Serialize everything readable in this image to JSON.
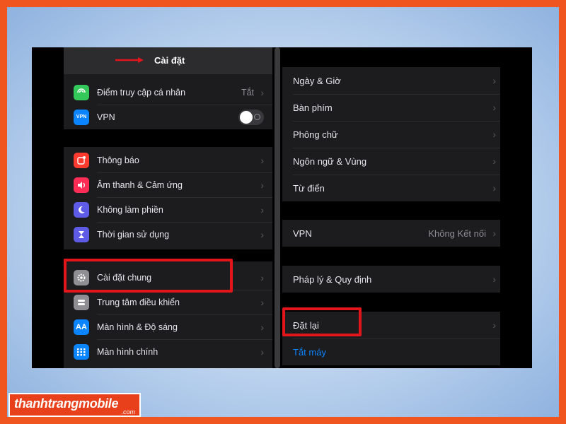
{
  "left_pane": {
    "title": "Cài đặt",
    "group1": [
      {
        "icon": "hotspot-icon",
        "color": "#34c759",
        "label": "Điểm truy cập cá nhân",
        "value": "Tắt"
      },
      {
        "icon": "vpn-icon",
        "icon_text": "VPN",
        "color": "#0a84ff",
        "label": "VPN",
        "toggle": false
      }
    ],
    "group2": [
      {
        "icon": "notifications-icon",
        "color": "#ff3b30",
        "label": "Thông báo"
      },
      {
        "icon": "sound-icon",
        "color": "#ff2d55",
        "label": "Âm thanh & Cảm ứng"
      },
      {
        "icon": "moon-icon",
        "color": "#5e5ce6",
        "label": "Không làm phiền"
      },
      {
        "icon": "hourglass-icon",
        "color": "#5e5ce6",
        "label": "Thời gian sử dụng"
      }
    ],
    "group3": [
      {
        "icon": "gear-icon",
        "color": "#8e8e93",
        "label": "Cài đặt chung"
      },
      {
        "icon": "control-center-icon",
        "color": "#8e8e93",
        "label": "Trung tâm điều khiển"
      },
      {
        "icon": "display-icon",
        "icon_text": "AA",
        "color": "#0a84ff",
        "label": "Màn hình & Độ sáng"
      },
      {
        "icon": "home-screen-icon",
        "color": "#0a84ff",
        "label": "Màn hình chính"
      }
    ]
  },
  "right_pane": {
    "group1": [
      {
        "label": "Ngày & Giờ"
      },
      {
        "label": "Bàn phím"
      },
      {
        "label": "Phông chữ"
      },
      {
        "label": "Ngôn ngữ & Vùng"
      },
      {
        "label": "Từ điển"
      }
    ],
    "vpn": {
      "label": "VPN",
      "value": "Không Kết nối"
    },
    "legal": {
      "label": "Pháp lý & Quy định"
    },
    "reset": {
      "label": "Đặt lại"
    },
    "shutdown": {
      "label": "Tắt máy",
      "color": "#0a84ff"
    }
  },
  "brand": {
    "name": "thanhtrangmobile",
    "tld": ".com"
  },
  "colors": {
    "highlight": "#e2151b",
    "frame": "#f0541f"
  }
}
